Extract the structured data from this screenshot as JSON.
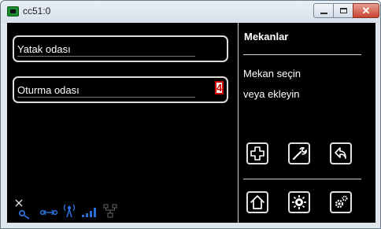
{
  "window": {
    "title": "cc51:0"
  },
  "rooms": [
    {
      "label": "Yatak odası"
    },
    {
      "label": "Oturma odası",
      "badge": "4"
    }
  ],
  "panel": {
    "title": "Mekanlar",
    "hint_line1": "Mekan seçin",
    "hint_line2": "veya ekleyin"
  },
  "toolbar": {
    "add_icon": "plus-icon",
    "edit_icon": "wrench-icon",
    "back_icon": "undo-icon",
    "home_icon": "home-icon",
    "scene_icon": "scene-icon",
    "settings_icon": "gears-icon"
  },
  "status_icons": [
    "antenna-off-icon",
    "link-icon",
    "signal-tower-icon",
    "signal-bars-icon",
    "network-icon"
  ],
  "colors": {
    "background": "#000000",
    "foreground": "#ffffff",
    "badge": "#d30000",
    "status_blue": "#2a6fd6"
  }
}
